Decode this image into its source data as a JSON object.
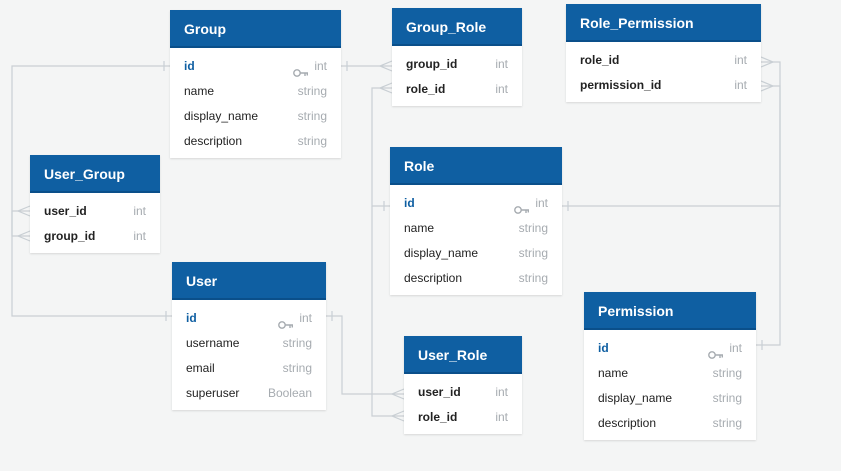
{
  "colors": {
    "header": "#0f5fa2",
    "background": "#f4f5f5",
    "connector": "#c9cfd4",
    "type_text": "#a6abb0"
  },
  "tables": {
    "group": {
      "title": "Group",
      "fields": [
        {
          "name": "id",
          "type": "int",
          "pk": true
        },
        {
          "name": "name",
          "type": "string"
        },
        {
          "name": "display_name",
          "type": "string"
        },
        {
          "name": "description",
          "type": "string"
        }
      ]
    },
    "group_role": {
      "title": "Group_Role",
      "fields": [
        {
          "name": "group_id",
          "type": "int",
          "fk": true
        },
        {
          "name": "role_id",
          "type": "int",
          "fk": true
        }
      ]
    },
    "role_permission": {
      "title": "Role_Permission",
      "fields": [
        {
          "name": "role_id",
          "type": "int",
          "fk": true
        },
        {
          "name": "permission_id",
          "type": "int",
          "fk": true
        }
      ]
    },
    "user_group": {
      "title": "User_Group",
      "fields": [
        {
          "name": "user_id",
          "type": "int",
          "fk": true
        },
        {
          "name": "group_id",
          "type": "int",
          "fk": true
        }
      ]
    },
    "role": {
      "title": "Role",
      "fields": [
        {
          "name": "id",
          "type": "int",
          "pk": true
        },
        {
          "name": "name",
          "type": "string"
        },
        {
          "name": "display_name",
          "type": "string"
        },
        {
          "name": "description",
          "type": "string"
        }
      ]
    },
    "user": {
      "title": "User",
      "fields": [
        {
          "name": "id",
          "type": "int",
          "pk": true
        },
        {
          "name": "username",
          "type": "string"
        },
        {
          "name": "email",
          "type": "string"
        },
        {
          "name": "superuser",
          "type": "Boolean"
        }
      ]
    },
    "permission": {
      "title": "Permission",
      "fields": [
        {
          "name": "id",
          "type": "int",
          "pk": true
        },
        {
          "name": "name",
          "type": "string"
        },
        {
          "name": "display_name",
          "type": "string"
        },
        {
          "name": "description",
          "type": "string"
        }
      ]
    },
    "user_role": {
      "title": "User_Role",
      "fields": [
        {
          "name": "user_id",
          "type": "int",
          "fk": true
        },
        {
          "name": "role_id",
          "type": "int",
          "fk": true
        }
      ]
    }
  }
}
